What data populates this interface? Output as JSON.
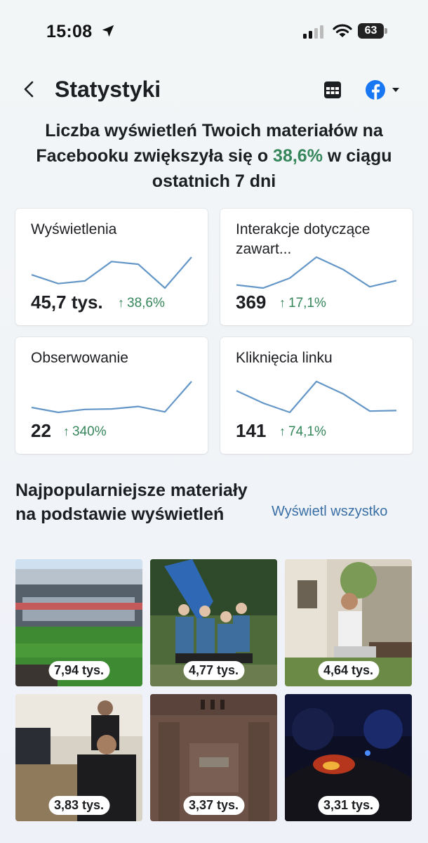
{
  "status_bar": {
    "time": "15:08",
    "battery": "63"
  },
  "header": {
    "title": "Statystyki"
  },
  "headline": {
    "before": "Liczba wyświetleń Twoich materiałów na Facebooku zwiększyła się o ",
    "highlight": "38,6%",
    "after": " w ciągu ostatnich 7 dni"
  },
  "stats": [
    {
      "label": "Wyświetlenia",
      "value": "45,7 tys.",
      "change": "38,6%",
      "trend": [
        3,
        2,
        2.3,
        4.5,
        4.2,
        1.5,
        5
      ]
    },
    {
      "label": "Interakcje dotyczące zawart...",
      "value": "369",
      "change": "17,1%",
      "trend": [
        1.5,
        1,
        2.6,
        6,
        4,
        1.2,
        2.2
      ]
    },
    {
      "label": "Obserwowanie",
      "value": "22",
      "change": "340%",
      "trend": [
        2.2,
        1.2,
        1.8,
        1.9,
        2.4,
        1.3,
        7.5
      ]
    },
    {
      "label": "Kliknięcia linku",
      "value": "141",
      "change": "74,1%",
      "trend": [
        5.5,
        3.5,
        2,
        7,
        5,
        2.2,
        2.3
      ]
    }
  ],
  "section": {
    "title": "Najpopularniejsze materiały na podstawie wyświetleń",
    "see_all": "Wyświetl wszystko"
  },
  "posts": [
    {
      "views": "7,94 tys."
    },
    {
      "views": "4,77 tys."
    },
    {
      "views": "4,64 tys."
    },
    {
      "views": "3,83 tys."
    },
    {
      "views": "3,37 tys."
    },
    {
      "views": "3,31 tys."
    }
  ],
  "colors": {
    "accent_green": "#36865b",
    "link_blue": "#3a6fa6",
    "sparkline": "#6497c7",
    "facebook_blue": "#1877f2"
  },
  "icons": [
    "location-arrow-icon",
    "signal-icon",
    "wifi-icon",
    "battery-icon",
    "back-chevron-icon",
    "calendar-icon",
    "facebook-icon",
    "caret-down-icon",
    "arrow-up-icon"
  ]
}
